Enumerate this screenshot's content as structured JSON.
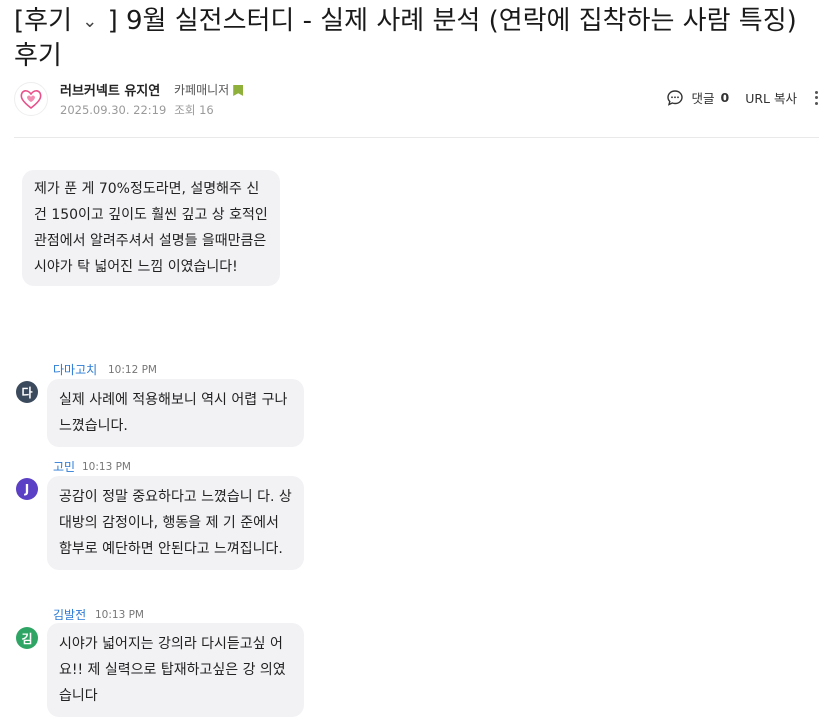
{
  "post": {
    "category": "[후기",
    "title_rest": "] 9월 실전스터디 - 실제 사례 분석 (연락에 집착하는 사람 특징) 후기",
    "author": "러브커넥트 유지연",
    "role": "카페매니저",
    "date": "2025.09.30. 22:19",
    "views": "조회 16",
    "comment_label": "댓글",
    "comment_count": "0",
    "url_copy": "URL 복사",
    "quote_text": "제가 푼 게 70%정도라면, 설명해주 신 건 150이고 깊이도 훨씬 깊고 상 호적인 관점에서 알려주셔서 설명들 을때만큼은 시야가 탁 넓어진 느낌 이였습니다!"
  },
  "comments": [
    {
      "avatar_letter": "다",
      "avatar_color": "#3b4a5c",
      "name": "다마고치",
      "time": "10:12 PM",
      "text": "실제 사례에 적용해보니 역시 어렵 구나 느꼈습니다."
    },
    {
      "avatar_letter": "J",
      "avatar_color": "#5b3fc4",
      "name": "고민",
      "time": "10:13 PM",
      "text": "공감이 정말 중요하다고 느꼈습니 다. 상대방의 감정이나, 행동을 제 기 준에서 함부로 예단하면 안된다고 느껴집니다."
    },
    {
      "avatar_letter": "김",
      "avatar_color": "#2fa565",
      "name": "김발전",
      "time": "10:13 PM",
      "text": "시야가 넓어지는 강의라 다시듣고싶 어요!! 제 실력으로 탑재하고싶은 강 의였습니다"
    }
  ]
}
